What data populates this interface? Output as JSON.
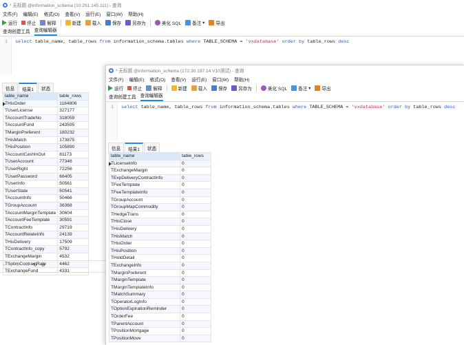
{
  "window1": {
    "title": "* 无标题 @information_schema (10.251.145.111) - 查询",
    "menu": [
      "文件(F)",
      "编辑(E)",
      "格式(O)",
      "查看(V)",
      "运行(E)",
      "窗口(W)",
      "帮助(H)"
    ],
    "toolbar": {
      "run": "运行",
      "stop": "停止",
      "explain": "解释",
      "new": "新建",
      "load": "载入",
      "save": "保存",
      "saveas": "另存为",
      "beautify": "美化 SQL",
      "note": "备注",
      "export": "导出"
    },
    "subtabs": [
      "查询创建工具",
      "查询编辑器"
    ],
    "line_number": "1",
    "sql": {
      "p1": "select",
      "p2": " table_name, table_rows ",
      "p3": "from",
      "p4": " information_schema.tables ",
      "p5": "where",
      "p6": " TABLE_SCHEMA = ",
      "p7": "'vxdatabase'",
      "p8": " order by ",
      "p9": "table_rows",
      "p10": " desc"
    },
    "result_tabs": [
      "信息",
      "结果1",
      "状态"
    ],
    "columns": [
      "table_name",
      "table_rows"
    ],
    "rows": [
      [
        "THisOrder",
        "1184806"
      ],
      [
        "TUserLicense",
        "327177"
      ],
      [
        "TAccountTradeNo",
        "318059"
      ],
      [
        "TAccountFund",
        "243595"
      ],
      [
        "TMarginPreferent",
        "180232"
      ],
      [
        "THisMatch",
        "173875"
      ],
      [
        "THisPosition",
        "105890"
      ],
      [
        "TAccountCashInOut",
        "81173"
      ],
      [
        "TUserAccount",
        "77346"
      ],
      [
        "TUserRight",
        "72256"
      ],
      [
        "TUserPassword",
        "66405"
      ],
      [
        "TUserInfo",
        "50561"
      ],
      [
        "TUserState",
        "50541"
      ],
      [
        "TAccountInfo",
        "50466"
      ],
      [
        "TGroupAccount",
        "36368"
      ],
      [
        "TAccountMarginTemplate",
        "30604"
      ],
      [
        "TAccountFeeTemplate",
        "30591"
      ],
      [
        "TContractInfo",
        "29719"
      ],
      [
        "TAccountRelateInfo",
        "24139"
      ],
      [
        "THisDelivery",
        "17509"
      ],
      [
        "TContractInfo_copy",
        "5792"
      ],
      [
        "TExchangeMargin",
        "4532"
      ],
      [
        "TSpbmContractRate",
        "4462"
      ],
      [
        "TExchangeFund",
        "4331"
      ]
    ],
    "status_icons": [
      "plus-icon",
      "minus-icon",
      "check-icon",
      "cross-icon",
      "refresh-icon",
      "stop-icon"
    ]
  },
  "window2": {
    "title": "* 无标题 @information_schema (172.30.197.14 V10测试) - 查询",
    "menu": [
      "文件(F)",
      "编辑(E)",
      "格式(O)",
      "查看(V)",
      "运行(E)",
      "窗口(W)",
      "帮助(H)"
    ],
    "toolbar": {
      "run": "运行",
      "stop": "停止",
      "explain": "解释",
      "new": "新建",
      "load": "载入",
      "save": "保存",
      "saveas": "另存为",
      "beautify": "美化 SQL",
      "note": "备注",
      "export": "导出"
    },
    "subtabs": [
      "查询创建工具",
      "查询编辑器"
    ],
    "line_number": "1",
    "sql": {
      "p1": "select",
      "p2": " table_name, table_rows ",
      "p3": "from",
      "p4": " information_schema.tables ",
      "p5": "where",
      "p6": " TABLE_SCHEMA = ",
      "p7": "'vxdatabase'",
      "p8": " order by ",
      "p9": "table_rows",
      "p10": " desc"
    },
    "result_tabs": [
      "信息",
      "结果1",
      "状态"
    ],
    "columns": [
      "table_name",
      "table_rows"
    ],
    "rows": [
      [
        "TLicenseInfo",
        "0"
      ],
      [
        "TExchangeMargin",
        "0"
      ],
      [
        "TExpDeliveryContractInfo",
        "0"
      ],
      [
        "TFeeTemplate",
        "0"
      ],
      [
        "TFeeTemplateInfo",
        "0"
      ],
      [
        "TGroupAccount",
        "0"
      ],
      [
        "TGroupMapCommodity",
        "0"
      ],
      [
        "THedgeTrans",
        "0"
      ],
      [
        "THisClose",
        "0"
      ],
      [
        "THisDelivery",
        "0"
      ],
      [
        "THisMatch",
        "0"
      ],
      [
        "THisOrder",
        "0"
      ],
      [
        "THisPosition",
        "0"
      ],
      [
        "THoldDetail",
        "0"
      ],
      [
        "TExchangeInfo",
        "0"
      ],
      [
        "TMarginPreferent",
        "0"
      ],
      [
        "TMarginTemplate",
        "0"
      ],
      [
        "TMarginTemplateInfo",
        "0"
      ],
      [
        "TMatchSummary",
        "0"
      ],
      [
        "TOperatorLogInfo",
        "0"
      ],
      [
        "TOptionExpirationReminder",
        "0"
      ],
      [
        "TOrderFee",
        "0"
      ],
      [
        "TParentAccount",
        "0"
      ],
      [
        "TPositionMortgage",
        "0"
      ],
      [
        "TPositionMove",
        "0"
      ]
    ]
  }
}
